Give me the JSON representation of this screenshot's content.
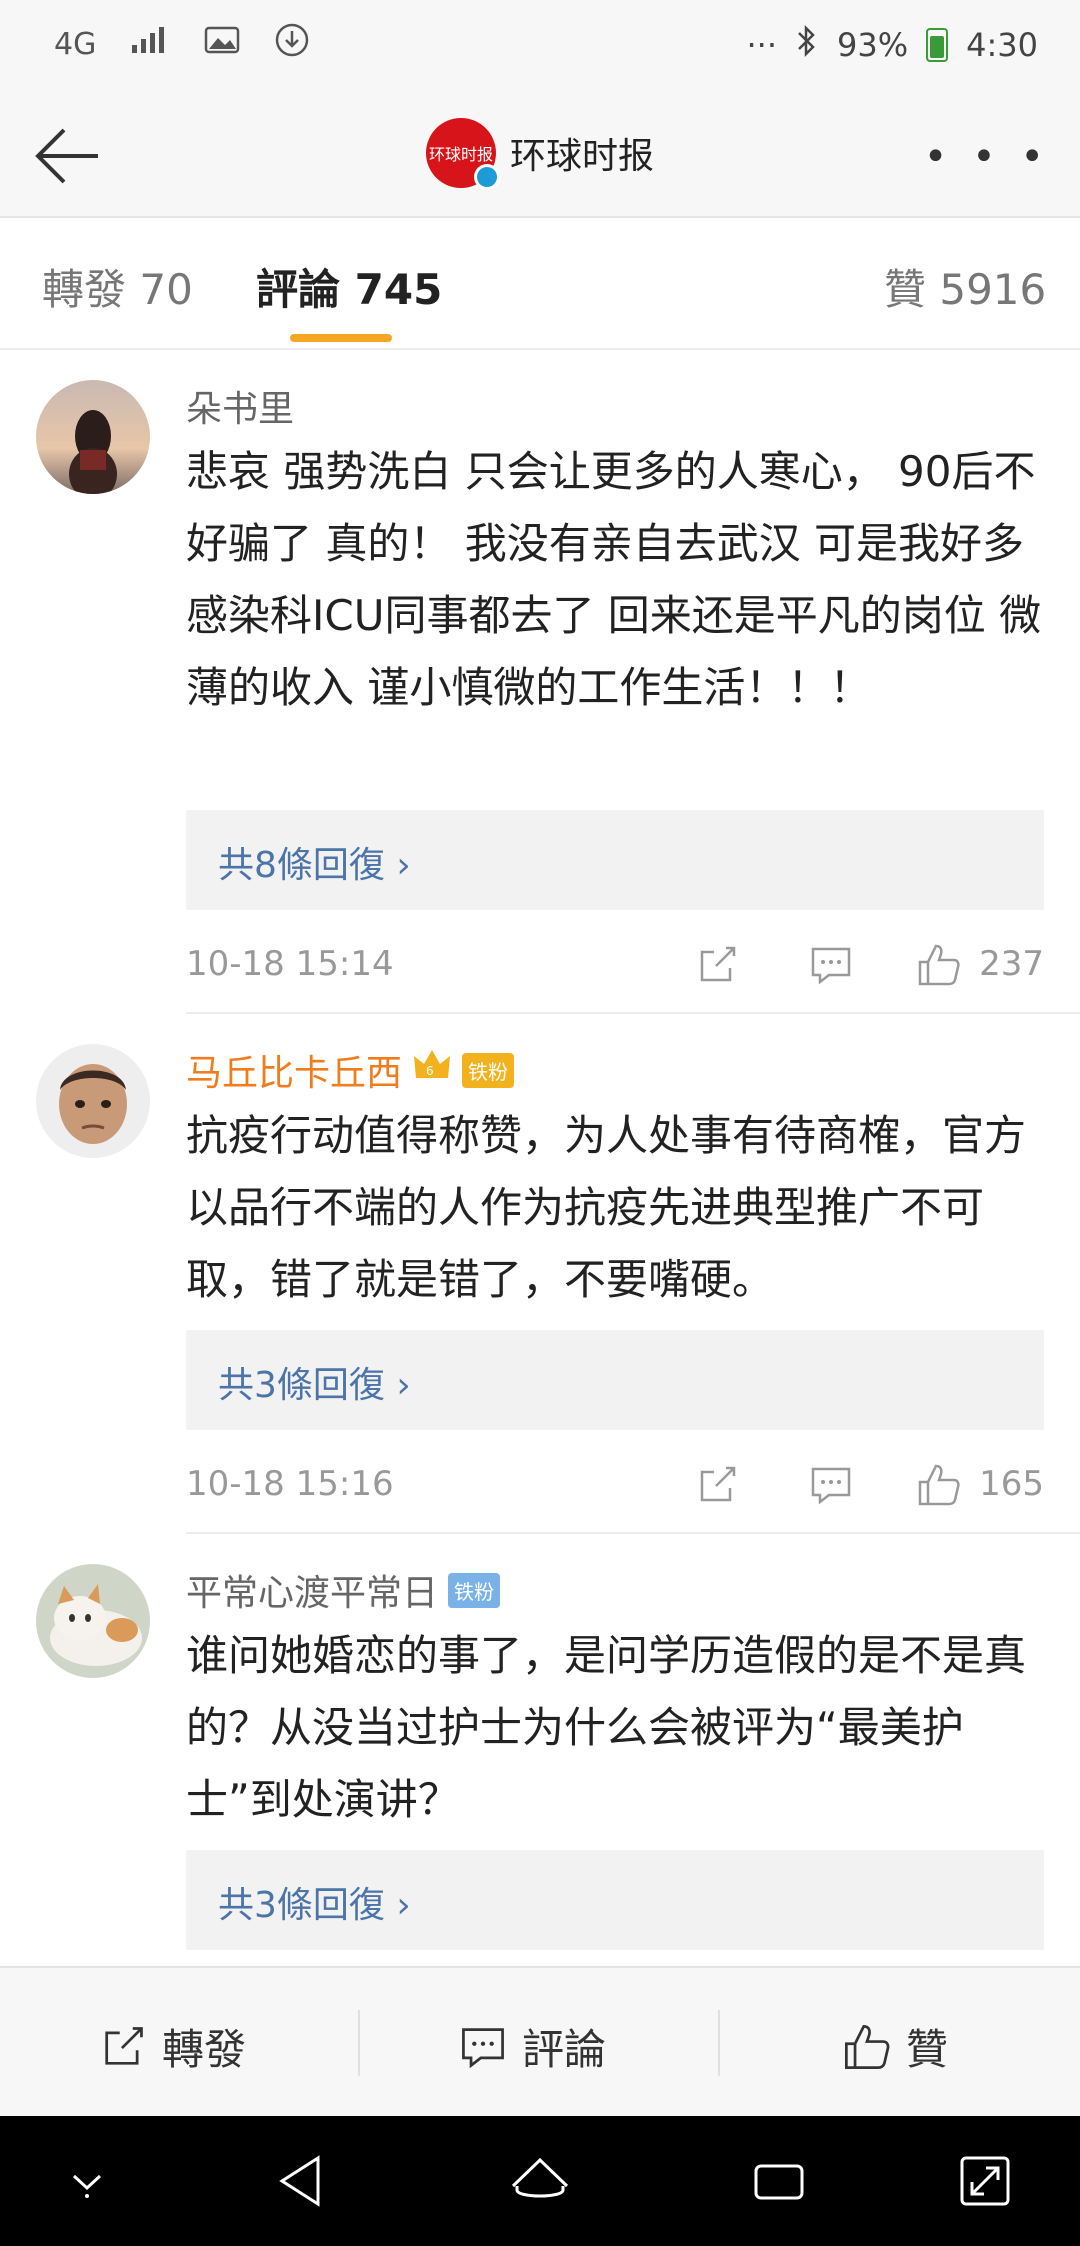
{
  "status_bar": {
    "network": "4G",
    "battery": "93%",
    "time": "4:30"
  },
  "nav": {
    "title": "环球时报",
    "logo_text": "环球时报",
    "more": "• • •"
  },
  "tabs": {
    "repost": "轉發 70",
    "comments": "評論 745",
    "likes": "贊 5916"
  },
  "comments": [
    {
      "username": "朵书里",
      "text": "悲哀 强势洗白 只会让更多的人寒心， 90后不好骗了 真的！ 我没有亲自去武汉 可是我好多感染科ICU同事都去了 回来还是平凡的岗位 微薄的收入 谨小慎微的工作生活！！！",
      "replies": "共8條回復 ›",
      "time": "10-18 15:14",
      "likes": "237"
    },
    {
      "username": "马丘比卡丘西",
      "badge": "铁粉",
      "text": "抗疫行动值得称赞，为人处事有待商榷，官方以品行不端的人作为抗疫先进典型推广不可取，错了就是错了，不要嘴硬。",
      "replies": "共3條回復 ›",
      "time": "10-18 15:16",
      "likes": "165"
    },
    {
      "username": "平常心渡平常日",
      "badge": "铁粉",
      "text": "谁问她婚恋的事了，是问学历造假的是不是真的？从没当过护士为什么会被评为“最美护士”到处演讲？",
      "replies": "共3條回復 ›"
    }
  ],
  "action_bar": {
    "repost": "轉發",
    "comment": "評論",
    "like": "贊"
  },
  "colors": {
    "accent": "#f5a623",
    "link": "#4b74a8",
    "gold_username": "#f07c1b"
  }
}
